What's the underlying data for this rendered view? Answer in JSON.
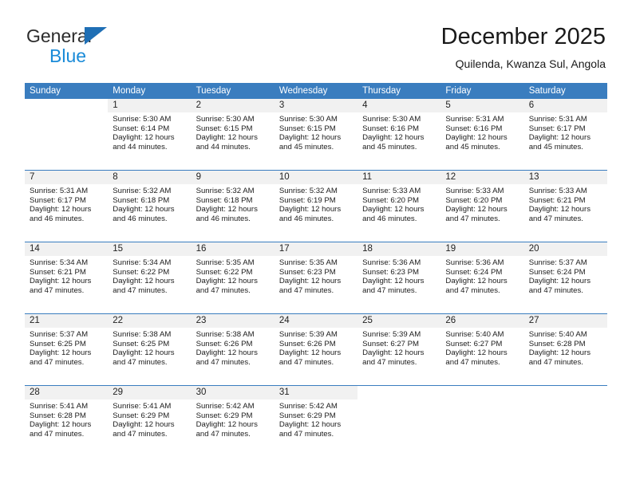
{
  "brand": {
    "line1": "General",
    "line2": "Blue",
    "triangle_color": "#1f6fb5",
    "line2_color": "#1a8bd8"
  },
  "header": {
    "title": "December 2025",
    "subtitle": "Quilenda, Kwanza Sul, Angola"
  },
  "theme": {
    "header_blue": "#3a7dbf",
    "daynum_band": "#f1f1f1",
    "cell_bg": "#ffffff"
  },
  "calendar": {
    "day_headers": [
      "Sunday",
      "Monday",
      "Tuesday",
      "Wednesday",
      "Thursday",
      "Friday",
      "Saturday"
    ],
    "weeks": [
      [
        {
          "day": "",
          "blank": true,
          "lines": []
        },
        {
          "day": "1",
          "lines": [
            "Sunrise: 5:30 AM",
            "Sunset: 6:14 PM",
            "Daylight: 12 hours",
            "and 44 minutes."
          ]
        },
        {
          "day": "2",
          "lines": [
            "Sunrise: 5:30 AM",
            "Sunset: 6:15 PM",
            "Daylight: 12 hours",
            "and 44 minutes."
          ]
        },
        {
          "day": "3",
          "lines": [
            "Sunrise: 5:30 AM",
            "Sunset: 6:15 PM",
            "Daylight: 12 hours",
            "and 45 minutes."
          ]
        },
        {
          "day": "4",
          "lines": [
            "Sunrise: 5:30 AM",
            "Sunset: 6:16 PM",
            "Daylight: 12 hours",
            "and 45 minutes."
          ]
        },
        {
          "day": "5",
          "lines": [
            "Sunrise: 5:31 AM",
            "Sunset: 6:16 PM",
            "Daylight: 12 hours",
            "and 45 minutes."
          ]
        },
        {
          "day": "6",
          "lines": [
            "Sunrise: 5:31 AM",
            "Sunset: 6:17 PM",
            "Daylight: 12 hours",
            "and 45 minutes."
          ]
        }
      ],
      [
        {
          "day": "7",
          "lines": [
            "Sunrise: 5:31 AM",
            "Sunset: 6:17 PM",
            "Daylight: 12 hours",
            "and 46 minutes."
          ]
        },
        {
          "day": "8",
          "lines": [
            "Sunrise: 5:32 AM",
            "Sunset: 6:18 PM",
            "Daylight: 12 hours",
            "and 46 minutes."
          ]
        },
        {
          "day": "9",
          "lines": [
            "Sunrise: 5:32 AM",
            "Sunset: 6:18 PM",
            "Daylight: 12 hours",
            "and 46 minutes."
          ]
        },
        {
          "day": "10",
          "lines": [
            "Sunrise: 5:32 AM",
            "Sunset: 6:19 PM",
            "Daylight: 12 hours",
            "and 46 minutes."
          ]
        },
        {
          "day": "11",
          "lines": [
            "Sunrise: 5:33 AM",
            "Sunset: 6:20 PM",
            "Daylight: 12 hours",
            "and 46 minutes."
          ]
        },
        {
          "day": "12",
          "lines": [
            "Sunrise: 5:33 AM",
            "Sunset: 6:20 PM",
            "Daylight: 12 hours",
            "and 47 minutes."
          ]
        },
        {
          "day": "13",
          "lines": [
            "Sunrise: 5:33 AM",
            "Sunset: 6:21 PM",
            "Daylight: 12 hours",
            "and 47 minutes."
          ]
        }
      ],
      [
        {
          "day": "14",
          "lines": [
            "Sunrise: 5:34 AM",
            "Sunset: 6:21 PM",
            "Daylight: 12 hours",
            "and 47 minutes."
          ]
        },
        {
          "day": "15",
          "lines": [
            "Sunrise: 5:34 AM",
            "Sunset: 6:22 PM",
            "Daylight: 12 hours",
            "and 47 minutes."
          ]
        },
        {
          "day": "16",
          "lines": [
            "Sunrise: 5:35 AM",
            "Sunset: 6:22 PM",
            "Daylight: 12 hours",
            "and 47 minutes."
          ]
        },
        {
          "day": "17",
          "lines": [
            "Sunrise: 5:35 AM",
            "Sunset: 6:23 PM",
            "Daylight: 12 hours",
            "and 47 minutes."
          ]
        },
        {
          "day": "18",
          "lines": [
            "Sunrise: 5:36 AM",
            "Sunset: 6:23 PM",
            "Daylight: 12 hours",
            "and 47 minutes."
          ]
        },
        {
          "day": "19",
          "lines": [
            "Sunrise: 5:36 AM",
            "Sunset: 6:24 PM",
            "Daylight: 12 hours",
            "and 47 minutes."
          ]
        },
        {
          "day": "20",
          "lines": [
            "Sunrise: 5:37 AM",
            "Sunset: 6:24 PM",
            "Daylight: 12 hours",
            "and 47 minutes."
          ]
        }
      ],
      [
        {
          "day": "21",
          "lines": [
            "Sunrise: 5:37 AM",
            "Sunset: 6:25 PM",
            "Daylight: 12 hours",
            "and 47 minutes."
          ]
        },
        {
          "day": "22",
          "lines": [
            "Sunrise: 5:38 AM",
            "Sunset: 6:25 PM",
            "Daylight: 12 hours",
            "and 47 minutes."
          ]
        },
        {
          "day": "23",
          "lines": [
            "Sunrise: 5:38 AM",
            "Sunset: 6:26 PM",
            "Daylight: 12 hours",
            "and 47 minutes."
          ]
        },
        {
          "day": "24",
          "lines": [
            "Sunrise: 5:39 AM",
            "Sunset: 6:26 PM",
            "Daylight: 12 hours",
            "and 47 minutes."
          ]
        },
        {
          "day": "25",
          "lines": [
            "Sunrise: 5:39 AM",
            "Sunset: 6:27 PM",
            "Daylight: 12 hours",
            "and 47 minutes."
          ]
        },
        {
          "day": "26",
          "lines": [
            "Sunrise: 5:40 AM",
            "Sunset: 6:27 PM",
            "Daylight: 12 hours",
            "and 47 minutes."
          ]
        },
        {
          "day": "27",
          "lines": [
            "Sunrise: 5:40 AM",
            "Sunset: 6:28 PM",
            "Daylight: 12 hours",
            "and 47 minutes."
          ]
        }
      ],
      [
        {
          "day": "28",
          "lines": [
            "Sunrise: 5:41 AM",
            "Sunset: 6:28 PM",
            "Daylight: 12 hours",
            "and 47 minutes."
          ]
        },
        {
          "day": "29",
          "lines": [
            "Sunrise: 5:41 AM",
            "Sunset: 6:29 PM",
            "Daylight: 12 hours",
            "and 47 minutes."
          ]
        },
        {
          "day": "30",
          "lines": [
            "Sunrise: 5:42 AM",
            "Sunset: 6:29 PM",
            "Daylight: 12 hours",
            "and 47 minutes."
          ]
        },
        {
          "day": "31",
          "lines": [
            "Sunrise: 5:42 AM",
            "Sunset: 6:29 PM",
            "Daylight: 12 hours",
            "and 47 minutes."
          ]
        },
        {
          "day": "",
          "blank": true,
          "lines": []
        },
        {
          "day": "",
          "blank": true,
          "lines": []
        },
        {
          "day": "",
          "blank": true,
          "lines": []
        }
      ]
    ]
  }
}
